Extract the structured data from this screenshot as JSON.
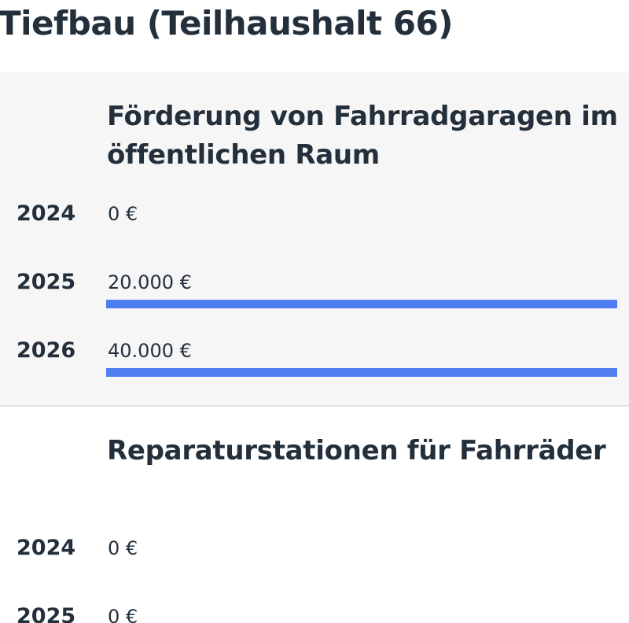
{
  "page_title": "Tiefbau (Teilhaushalt 66)",
  "bar_color": "#4f7ef2",
  "sections": [
    {
      "title": "Förderung von Fahrradgaragen im öffentlichen Raum",
      "rows": [
        {
          "year": "2024",
          "amount": "0 €",
          "bar_fraction": 0
        },
        {
          "year": "2025",
          "amount": "20.000 €",
          "bar_fraction": 1
        },
        {
          "year": "2026",
          "amount": "40.000 €",
          "bar_fraction": 1
        }
      ]
    },
    {
      "title": "Reparaturstationen für Fahrräder",
      "rows": [
        {
          "year": "2024",
          "amount": "0 €",
          "bar_fraction": 0
        },
        {
          "year": "2025",
          "amount": "0 €",
          "bar_fraction": 0
        }
      ]
    }
  ]
}
